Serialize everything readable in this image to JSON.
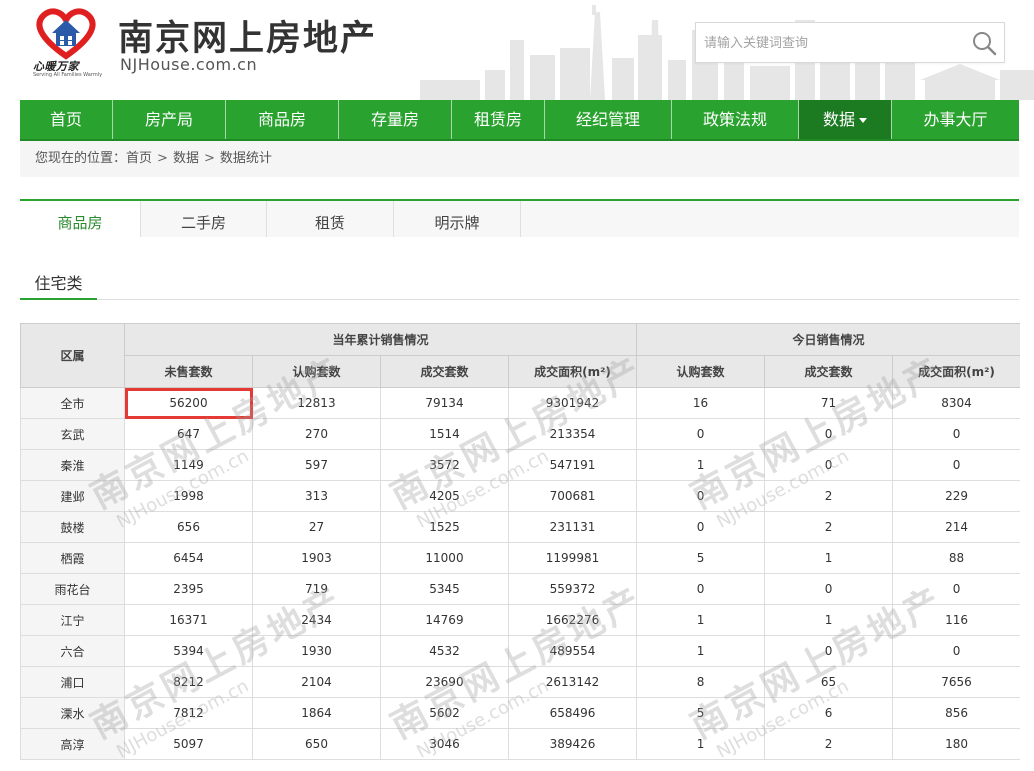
{
  "site": {
    "title": "南京网上房地产",
    "domain": "NJHouse.com.cn",
    "logo_cap": "心暖万家",
    "logo_sub": "Serving All Families Warmly"
  },
  "search": {
    "placeholder": "请输入关键词查询"
  },
  "nav": {
    "items": [
      "首页",
      "房产局",
      "商品房",
      "存量房",
      "租赁房",
      "经纪管理",
      "政策法规",
      "数据",
      "办事大厅"
    ],
    "active": "数据"
  },
  "breadcrumb": {
    "prefix": "您现在的位置：",
    "items": [
      "首页",
      "数据",
      "数据统计"
    ]
  },
  "subtabs": {
    "items": [
      "商品房",
      "二手房",
      "租赁",
      "明示牌"
    ],
    "active": "商品房"
  },
  "section": {
    "title": "住宅类"
  },
  "table": {
    "area_header": "区属",
    "group1": "当年累计销售情况",
    "group2": "今日销售情况",
    "columns": [
      "未售套数",
      "认购套数",
      "成交套数",
      "成交面积(m²)",
      "认购套数",
      "成交套数",
      "成交面积(m²)"
    ],
    "rows": [
      [
        "全市",
        "56200",
        "12813",
        "79134",
        "9301942",
        "16",
        "71",
        "8304"
      ],
      [
        "玄武",
        "647",
        "270",
        "1514",
        "213354",
        "0",
        "0",
        "0"
      ],
      [
        "秦淮",
        "1149",
        "597",
        "3572",
        "547191",
        "1",
        "0",
        "0"
      ],
      [
        "建邺",
        "1998",
        "313",
        "4205",
        "700681",
        "0",
        "2",
        "229"
      ],
      [
        "鼓楼",
        "656",
        "27",
        "1525",
        "231131",
        "0",
        "2",
        "214"
      ],
      [
        "栖霞",
        "6454",
        "1903",
        "11000",
        "1199981",
        "5",
        "1",
        "88"
      ],
      [
        "雨花台",
        "2395",
        "719",
        "5345",
        "559372",
        "0",
        "0",
        "0"
      ],
      [
        "江宁",
        "16371",
        "2434",
        "14769",
        "1662276",
        "1",
        "1",
        "116"
      ],
      [
        "六合",
        "5394",
        "1930",
        "4532",
        "489554",
        "1",
        "0",
        "0"
      ],
      [
        "浦口",
        "8212",
        "2104",
        "23690",
        "2613142",
        "8",
        "65",
        "7656"
      ],
      [
        "溧水",
        "7812",
        "1864",
        "5602",
        "658496",
        "5",
        "6",
        "856"
      ],
      [
        "高淳",
        "5097",
        "650",
        "3046",
        "389426",
        "1",
        "2",
        "180"
      ]
    ]
  },
  "colors": {
    "nav_green": "#2aa22f",
    "nav_active": "#1c7a21",
    "highlight": "#e53935",
    "logo_red": "#e02020"
  }
}
